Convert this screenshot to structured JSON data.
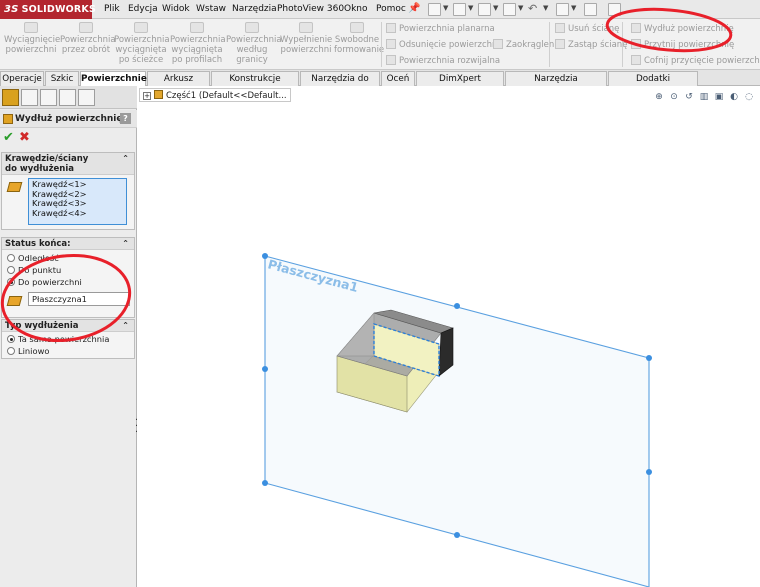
{
  "app": {
    "logo_prefix": "3S",
    "logo": "SOLIDWORKS"
  },
  "menu": [
    "Plik",
    "Edycja",
    "Widok",
    "Wstaw",
    "Narzędzia",
    "PhotoView 360",
    "Okno",
    "Pomoc"
  ],
  "commands": {
    "big": [
      {
        "label": "Wyciągnięcie powierzchni"
      },
      {
        "label": "Powierzchnia przez obrót"
      },
      {
        "label": "Powierzchnia wyciągnięta po ścieżce"
      },
      {
        "label": "Powierzchnia wyciągnięta po profilach"
      },
      {
        "label": "Powierzchnia według granicy"
      },
      {
        "label": "Wypełnienie powierzchni"
      },
      {
        "label": "Swobodne formowanie"
      }
    ],
    "col1": [
      "Powierzchnia planarna",
      "Odsunięcie powierzchni",
      "Powierzchnia rozwijalna"
    ],
    "zaokraglenie": "Zaokrąglenie",
    "col2": [
      "Usuń ścianę",
      "Zastąp ścianę"
    ],
    "col3": [
      "Wydłuż powierzchnię",
      "Przytnij powierzchnię",
      "Cofnij przycięcie powierzchni"
    ]
  },
  "tabs": [
    "Operacje",
    "Szkic",
    "Powierzchnie",
    "Arkusz blachy",
    "Konstrukcje spawane",
    "Narzędzia do form",
    "Oceń",
    "DimXpert Wymiarów",
    "Narzędzia renderowania",
    "Dodatki SOLIDWORKS"
  ],
  "active_tab": "Powierzchnie",
  "property_manager": {
    "title": "Wydłuż powierzchnię",
    "help": "?",
    "edges_group": {
      "title_line1": "Krawędzie/ściany",
      "title_line2": "do wydłużenia",
      "items": [
        "Krawędź<1>",
        "Krawędź<2>",
        "Krawędź<3>",
        "Krawędź<4>"
      ]
    },
    "end_group": {
      "title": "Status końca:",
      "options": [
        "Odległość",
        "Do punktu",
        "Do powierzchni"
      ],
      "selected": 2,
      "field_value": "Płaszczyzna1"
    },
    "type_group": {
      "title": "Typ wydłużenia",
      "options": [
        "Ta sama powierzchnia",
        "Liniowo"
      ],
      "selected": 0
    }
  },
  "tree": {
    "item": "Część1  (Default<<Default..."
  },
  "scene": {
    "plane_label": "Płaszczyzna1"
  },
  "colors": {
    "brand": "#b3262f",
    "plane": "#5aa0e0",
    "annotation": "#e8202a",
    "selection": "#3f8fd6"
  }
}
